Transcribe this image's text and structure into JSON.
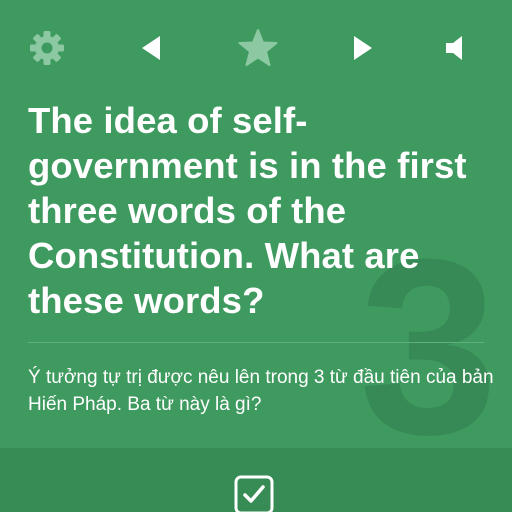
{
  "toolbar": {
    "icons": [
      "gear-icon",
      "previous-icon",
      "star-icon",
      "next-icon",
      "speaker-icon"
    ]
  },
  "card": {
    "number": "3",
    "question": "The idea of self-government is in the first three words of the Constitution. What are these words?",
    "translation": "Ý tưởng tự trị được nêu lên trong 3 từ đầu tiên của bản Hiến Pháp. Ba từ này là gì?"
  },
  "bottom": {
    "icon": "check-icon"
  },
  "colors": {
    "background": "#3e9a5f",
    "bottom_bar": "#378b54",
    "icon_dim": "#8cc8a2",
    "text": "#ffffff"
  }
}
